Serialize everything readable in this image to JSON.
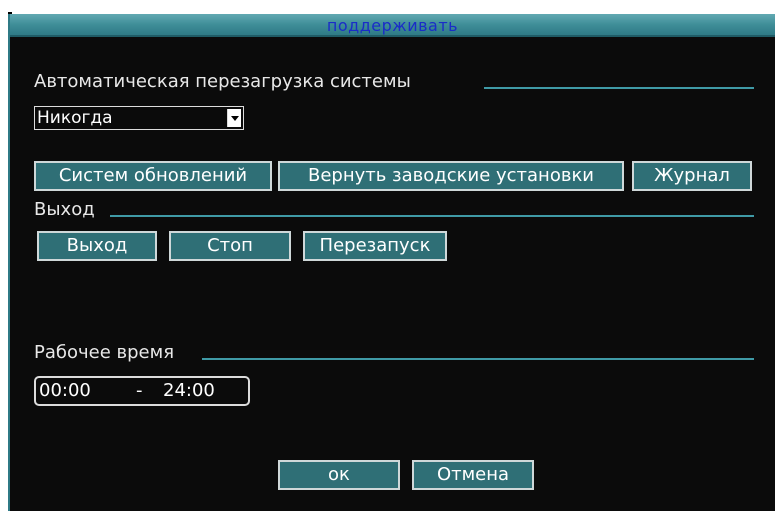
{
  "window": {
    "title": "поддерживать"
  },
  "auto_reboot": {
    "label": "Автоматическая перезагрузка системы",
    "selected": "Никогда"
  },
  "maintenance_buttons": {
    "update_label": "Систем обновлений",
    "factory_reset_label": "Вернуть заводские установки",
    "log_label": "Журнал"
  },
  "exit_section": {
    "label": "Выход",
    "exit_label": "Выход",
    "stop_label": "Стоп",
    "restart_label": "Перезапуск"
  },
  "work_time": {
    "label": "Рабочее время",
    "start": "00:00",
    "separator": "-",
    "end": "24:00"
  },
  "footer": {
    "ok_label": "ок",
    "cancel_label": "Отмена"
  }
}
